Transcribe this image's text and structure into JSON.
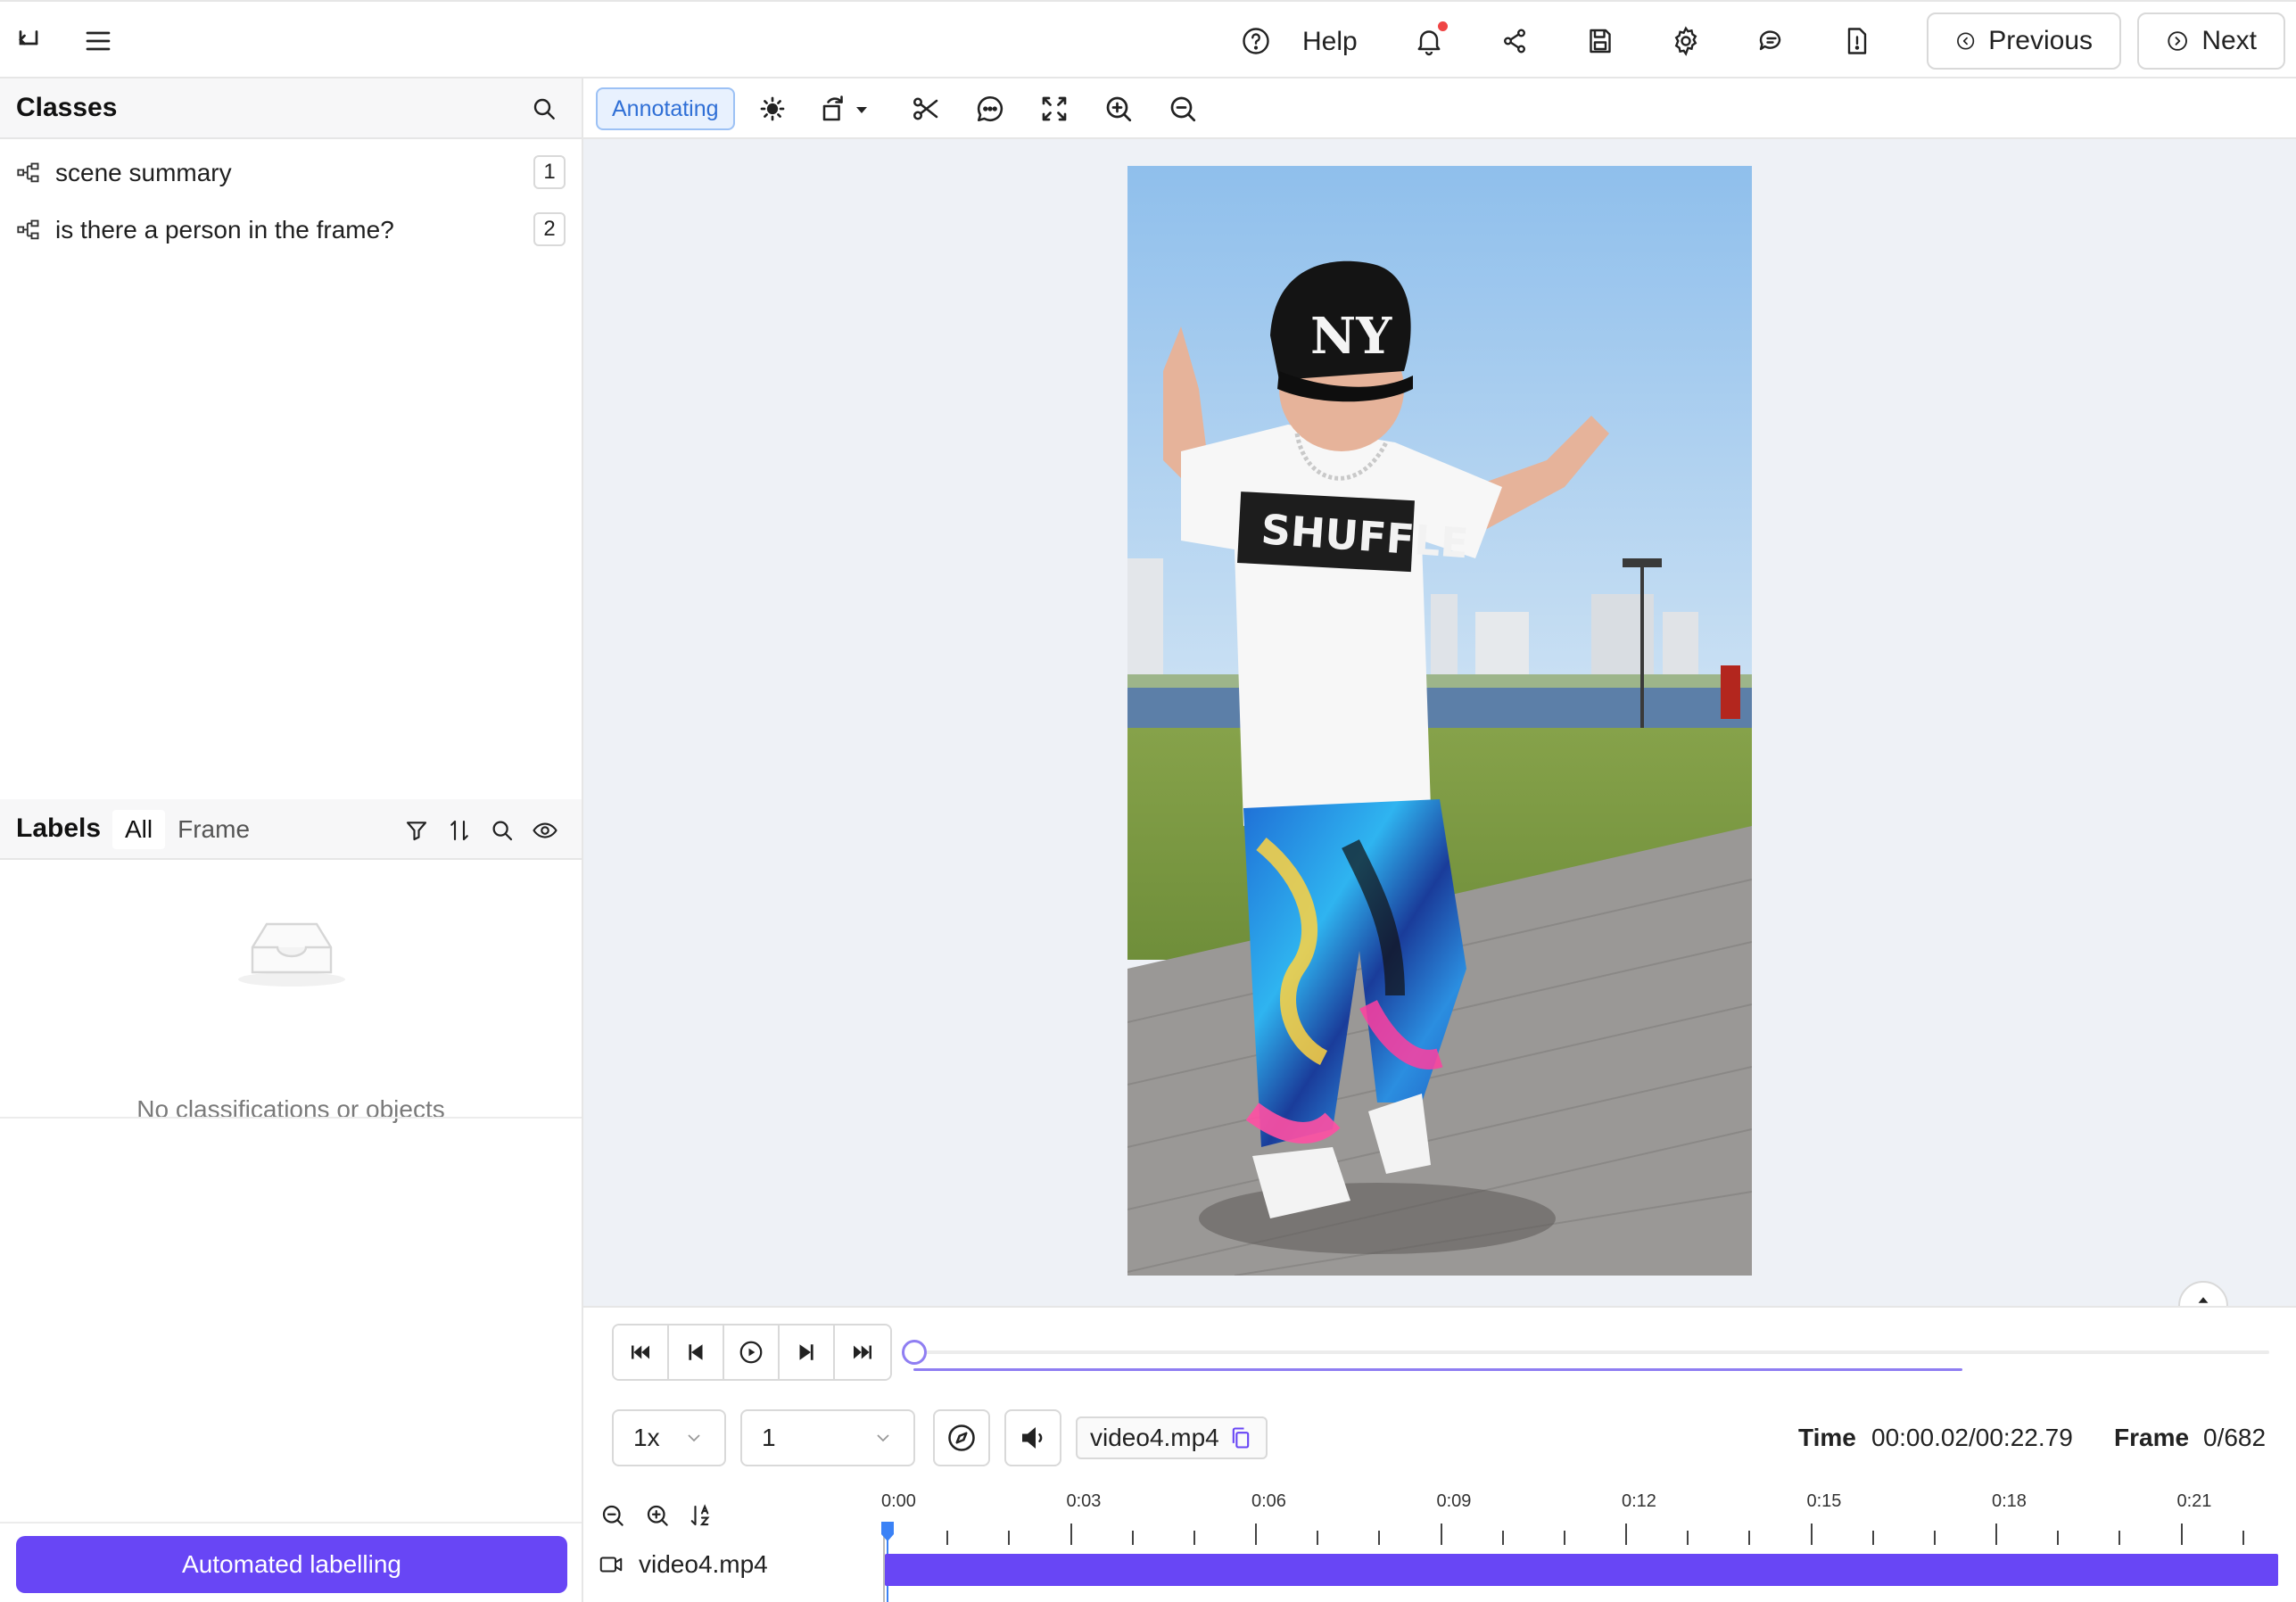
{
  "topbar": {
    "help_label": "Help",
    "previous_label": "Previous",
    "next_label": "Next"
  },
  "classes_panel": {
    "title": "Classes",
    "items": [
      {
        "label": "scene summary",
        "key": "1"
      },
      {
        "label": "is there a person in the frame?",
        "key": "2"
      }
    ]
  },
  "labels_panel": {
    "title": "Labels",
    "tabs": [
      "All",
      "Frame"
    ],
    "active_tab": "All",
    "empty_message": "No classifications or objects"
  },
  "automated_labelling_label": "Automated labelling",
  "toolbar": {
    "mode_label": "Annotating"
  },
  "player": {
    "speed": "1x",
    "step": "1",
    "file_name": "video4.mp4",
    "time_label": "Time",
    "time_value": "00:00.02/00:22.79",
    "frame_label": "Frame",
    "frame_value": "0/682",
    "progress_fraction": 0.0009
  },
  "timeline": {
    "ticks": [
      "0:00",
      "0:03",
      "0:06",
      "0:09",
      "0:12",
      "0:15",
      "0:18",
      "0:21"
    ],
    "track_name": "video4.mp4"
  },
  "colors": {
    "accent": "#6846f5",
    "seek": "#8f7ef2",
    "mode_badge_text": "#2f6fd6",
    "notification_dot": "#ef4444"
  },
  "frame_overlay": {
    "shirt_text": "SHUFFLE",
    "cap_text": "NY"
  }
}
